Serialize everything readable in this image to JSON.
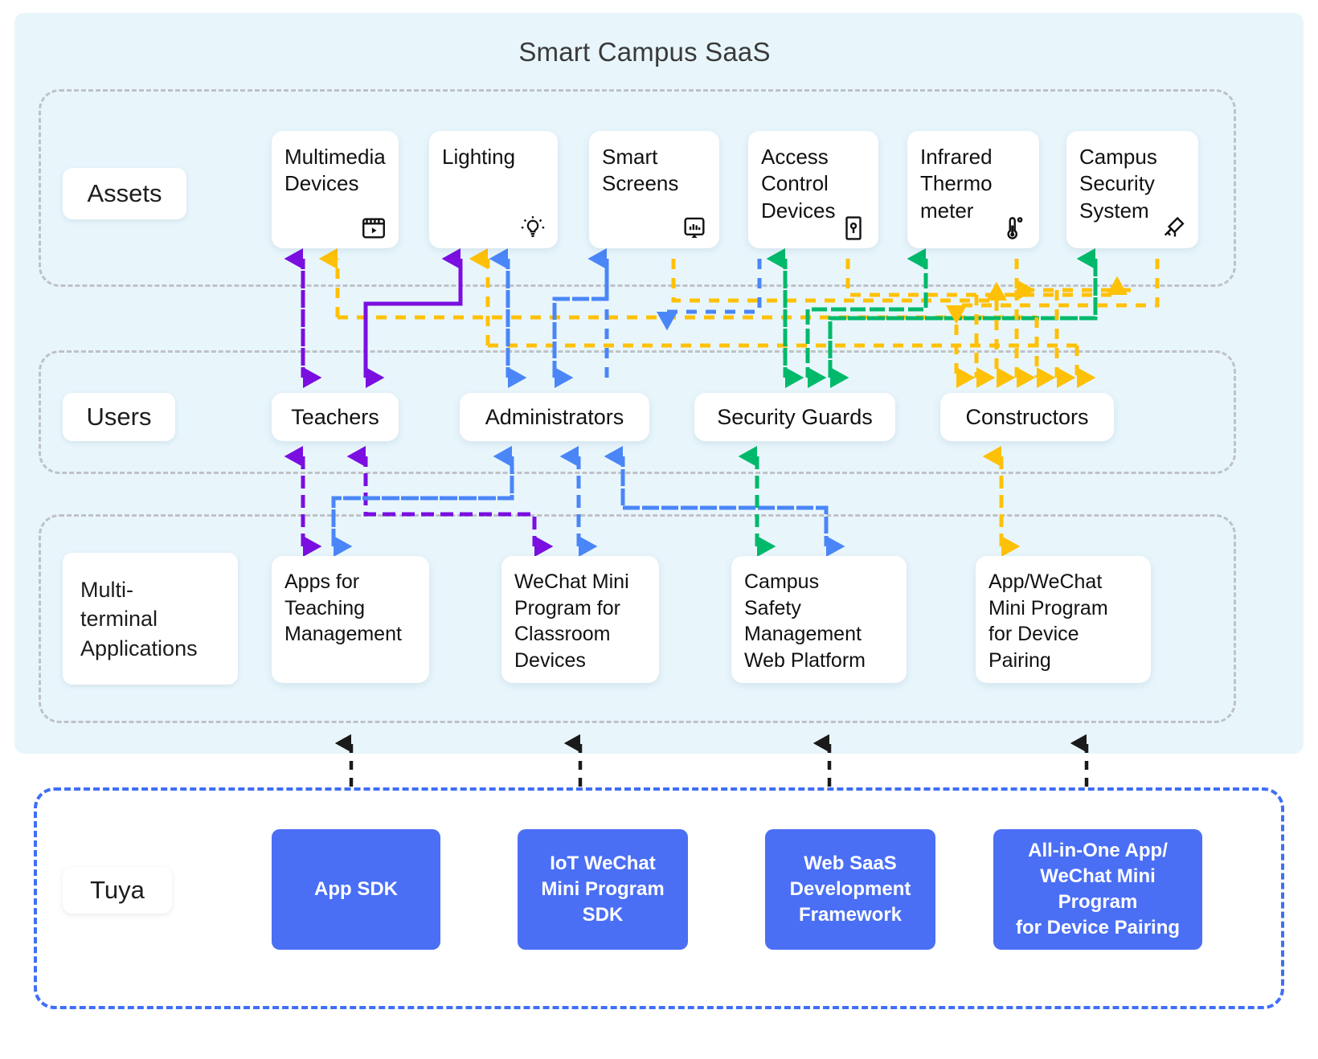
{
  "diagram": {
    "title": "Smart Campus SaaS",
    "background_color": "#E8F6FC",
    "accent_color": "#4a6ff5"
  },
  "flow_colors": {
    "purple": "#7A0FE0",
    "blue": "#4a86f7",
    "green": "#00B96B",
    "yellow": "#FFC107",
    "black": "#1a1a1a",
    "group_border": "#BFC2C6"
  },
  "rows": {
    "assets": {
      "label": "Assets",
      "items": [
        {
          "label": "Multimedia\nDevices",
          "icon": "media-player-icon"
        },
        {
          "label": "Lighting",
          "icon": "light-bulb-icon"
        },
        {
          "label": "Smart\nScreens",
          "icon": "smart-screen-icon"
        },
        {
          "label": "Access\nControl\nDevices",
          "icon": "door-key-icon"
        },
        {
          "label": "Infrared\nThermo\nmeter",
          "icon": "thermometer-icon"
        },
        {
          "label": "Campus\nSecurity\nSystem",
          "icon": "security-camera-icon"
        }
      ]
    },
    "users": {
      "label": "Users",
      "items": [
        {
          "label": "Teachers"
        },
        {
          "label": "Administrators"
        },
        {
          "label": "Security Guards"
        },
        {
          "label": "Constructors"
        }
      ]
    },
    "applications": {
      "label": "Multi-\nterminal\nApplications",
      "items": [
        {
          "label": "Apps for\nTeaching\nManagement"
        },
        {
          "label": "WeChat Mini\nProgram for\nClassroom\nDevices"
        },
        {
          "label": "Campus\nSafety\nManagement\nWeb Platform"
        },
        {
          "label": "App/WeChat\nMini Program\nfor Device\nPairing"
        }
      ]
    },
    "tuya": {
      "label": "Tuya",
      "items": [
        {
          "label": "App SDK"
        },
        {
          "label": "IoT WeChat\nMini Program\nSDK"
        },
        {
          "label": "Web SaaS\nDevelopment\nFramework"
        },
        {
          "label": "All-in-One App/\nWeChat Mini Program\nfor Device Pairing"
        }
      ]
    }
  }
}
